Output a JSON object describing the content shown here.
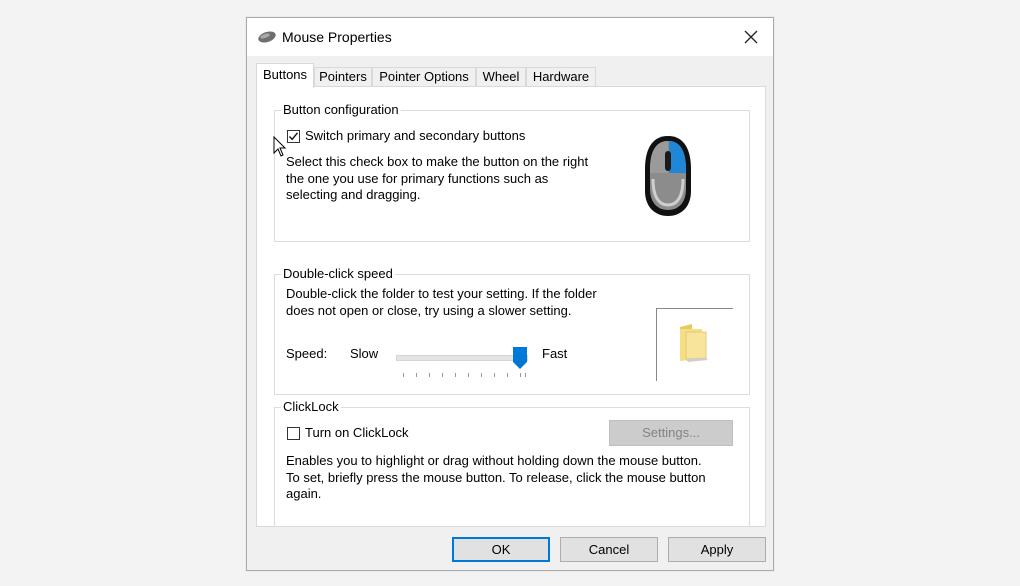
{
  "window": {
    "title": "Mouse Properties"
  },
  "tabs": [
    "Buttons",
    "Pointers",
    "Pointer Options",
    "Wheel",
    "Hardware"
  ],
  "active_tab": "Buttons",
  "button_config": {
    "title": "Button configuration",
    "switch_label": "Switch primary and secondary buttons",
    "switch_checked": true,
    "description_lines": [
      "Select this check box to make the button on the right",
      "the one you use for primary functions such as",
      "selecting and dragging."
    ],
    "accent_color": "#0078d7"
  },
  "double_click": {
    "title": "Double-click speed",
    "description_lines": [
      "Double-click the folder to test your setting. If the folder",
      "does not open or close, try using a slower setting."
    ],
    "speed_label": "Speed:",
    "slow_label": "Slow",
    "fast_label": "Fast",
    "slider_fraction": 0.95
  },
  "clicklock": {
    "title": "ClickLock",
    "toggle_label": "Turn on ClickLock",
    "toggle_checked": false,
    "settings_label": "Settings...",
    "description_lines": [
      "Enables you to highlight or drag without holding down the mouse button.",
      "To set, briefly press the mouse button. To release, click the mouse button",
      "again."
    ]
  },
  "footer": {
    "ok": "OK",
    "cancel": "Cancel",
    "apply": "Apply"
  },
  "icons": {
    "title": "mouse-icon",
    "close": "close-icon",
    "illustration": "mouse-illustration-icon",
    "folder": "folder-icon",
    "checkmark": "checkmark-icon",
    "cursor": "mouse-cursor-icon"
  }
}
